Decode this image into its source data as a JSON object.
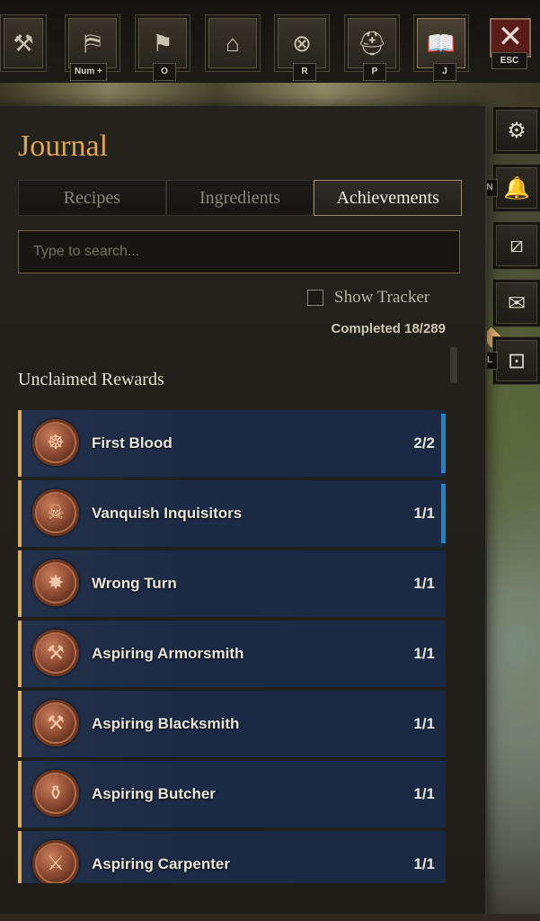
{
  "topbar": {
    "buttons": [
      {
        "icon": "hammer-icon",
        "glyph": "⚒",
        "key": ""
      },
      {
        "icon": "map-icon",
        "glyph": "⛿",
        "key": "Num +"
      },
      {
        "icon": "banner-icon",
        "glyph": "⚑",
        "key": "O"
      },
      {
        "icon": "market-stall-icon",
        "glyph": "⌂",
        "key": ""
      },
      {
        "icon": "compass-icon",
        "glyph": "⊗",
        "key": "R"
      },
      {
        "icon": "helmet-icon",
        "glyph": "⛑",
        "key": "P"
      },
      {
        "icon": "book-icon",
        "glyph": "📖",
        "key": "J"
      }
    ],
    "close_glyph": "✕",
    "close_key": "ESC"
  },
  "side": {
    "buttons": [
      {
        "icon": "gear-icon",
        "glyph": "⚙",
        "key": ""
      },
      {
        "icon": "bell-icon",
        "glyph": "🔔",
        "key": "N"
      },
      {
        "icon": "basket-icon",
        "glyph": "⧄",
        "key": ""
      },
      {
        "icon": "mail-icon",
        "glyph": "✉",
        "key": ""
      },
      {
        "icon": "chest-icon",
        "glyph": "⊡",
        "key": "L"
      }
    ]
  },
  "journal": {
    "title": "Journal",
    "tabs": [
      "Recipes",
      "Ingredients",
      "Achievements"
    ],
    "active_tab": "Achievements",
    "search_placeholder": "Type to search...",
    "show_tracker_label": "Show Tracker",
    "completed_label": "Completed 18/289",
    "section_title": "Unclaimed Rewards",
    "achievements": [
      {
        "name": "First Blood",
        "count": "2/2",
        "glyph": "☸",
        "icon": "antlers-medal-icon",
        "marker": true
      },
      {
        "name": "Vanquish Inquisitors",
        "count": "1/1",
        "glyph": "☠",
        "icon": "skull-medal-icon",
        "marker": true
      },
      {
        "name": "Wrong Turn",
        "count": "1/1",
        "glyph": "✸",
        "icon": "star-compass-medal-icon",
        "marker": false
      },
      {
        "name": "Aspiring Armorsmith",
        "count": "1/1",
        "glyph": "⚒",
        "icon": "anvil-medal-icon",
        "marker": false
      },
      {
        "name": "Aspiring Blacksmith",
        "count": "1/1",
        "glyph": "⚒",
        "icon": "anvil-medal-icon",
        "marker": false
      },
      {
        "name": "Aspiring Butcher",
        "count": "1/1",
        "glyph": "⚱",
        "icon": "pot-medal-icon",
        "marker": false
      },
      {
        "name": "Aspiring Carpenter",
        "count": "1/1",
        "glyph": "⚔",
        "icon": "tools-medal-icon",
        "marker": false
      }
    ]
  },
  "colors": {
    "accent": "#e1a550",
    "row_bg": "#1b2a45",
    "row_left_bar": "#e2a95a",
    "row_marker": "#1a86d0"
  }
}
